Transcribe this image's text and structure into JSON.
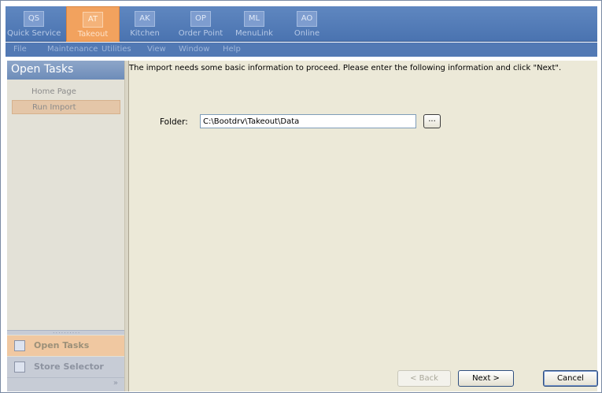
{
  "modules": [
    {
      "abbr": "QS",
      "label": "Quick Service",
      "active": false
    },
    {
      "abbr": "AT",
      "label": "Takeout",
      "active": true
    },
    {
      "abbr": "AK",
      "label": "Kitchen",
      "active": false
    },
    {
      "abbr": "OP",
      "label": "Order Point",
      "active": false
    },
    {
      "abbr": "ML",
      "label": "MenuLink",
      "active": false
    },
    {
      "abbr": "AO",
      "label": "Online",
      "active": false
    }
  ],
  "menu": [
    "File",
    "Maintenance",
    "Utilities",
    "View",
    "Window",
    "Help"
  ],
  "left_panel": {
    "header": "Open Tasks",
    "items": [
      {
        "label": "Home Page",
        "selected": false
      },
      {
        "label": "Run Import",
        "selected": true
      }
    ],
    "splitter_grip": "..........",
    "nav_open_tasks": "Open Tasks",
    "nav_store_selector": "Store Selector",
    "overflow": "»"
  },
  "main": {
    "instructions": "The import needs some basic information to proceed.  Please enter the following information and click \"Next\".",
    "folder_label": "Folder:",
    "folder_value": "C:\\Bootdrv\\Takeout\\Data",
    "browse_label": "...",
    "back_label": "< Back",
    "next_label": "Next >",
    "cancel_label": "Cancel"
  }
}
